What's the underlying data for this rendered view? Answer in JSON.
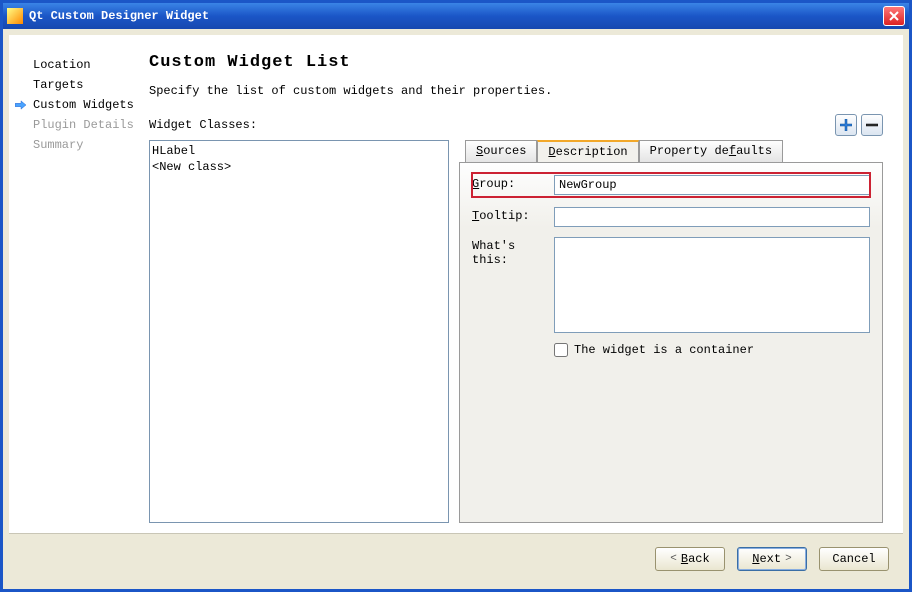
{
  "window": {
    "title": "Qt Custom Designer Widget"
  },
  "sidebar": {
    "items": [
      {
        "label": "Location",
        "state": "normal"
      },
      {
        "label": "Targets",
        "state": "normal"
      },
      {
        "label": "Custom Widgets",
        "state": "current"
      },
      {
        "label": "Plugin Details",
        "state": "disabled"
      },
      {
        "label": "Summary",
        "state": "disabled"
      }
    ]
  },
  "page": {
    "title": "Custom Widget List",
    "subtitle": "Specify the list of custom widgets and their properties.",
    "classes_label": "Widget Classes:",
    "list": [
      "HLabel",
      "<New class>"
    ]
  },
  "tabs": {
    "sources": {
      "label_pre": "",
      "label_u": "S",
      "label_post": "ources"
    },
    "description": {
      "label_pre": "",
      "label_u": "D",
      "label_post": "escription"
    },
    "property": {
      "label_pre": "Property de",
      "label_u": "f",
      "label_post": "aults"
    },
    "active": "description"
  },
  "form": {
    "group": {
      "label_pre": "",
      "label_u": "G",
      "label_post": "roup:",
      "value": "NewGroup"
    },
    "tooltip": {
      "label_pre": "",
      "label_u": "T",
      "label_post": "ooltip:",
      "value": ""
    },
    "whatsthis": {
      "label": "What's this:",
      "value": ""
    },
    "container": {
      "label_pre": "The widget is a c",
      "label_u": "o",
      "label_post": "ntainer",
      "checked": false
    }
  },
  "footer": {
    "back": {
      "u": "B",
      "post": "ack"
    },
    "next": {
      "u": "N",
      "post": "ext"
    },
    "cancel": "Cancel"
  }
}
